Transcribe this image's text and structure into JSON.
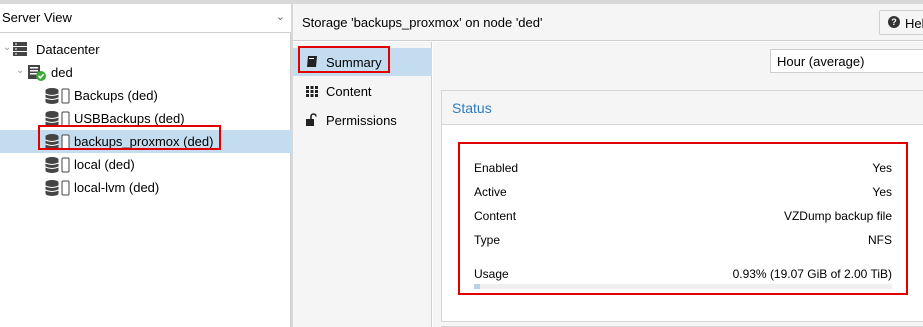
{
  "tree": {
    "view_selector": "Server View",
    "datacenter": "Datacenter",
    "node": "ded",
    "storages": [
      "Backups (ded)",
      "USBBackups (ded)",
      "backups_proxmox (ded)",
      "local (ded)",
      "local-lvm (ded)"
    ],
    "selected_index": 2
  },
  "header": {
    "title": "Storage 'backups_proxmox' on node 'ded'",
    "help_label": "Hel"
  },
  "subnav": {
    "items": [
      "Summary",
      "Content",
      "Permissions"
    ],
    "active": "Summary"
  },
  "toolbar": {
    "timeframe": "Hour (average)"
  },
  "status": {
    "title": "Status",
    "rows": [
      {
        "label": "Enabled",
        "value": "Yes"
      },
      {
        "label": "Active",
        "value": "Yes"
      },
      {
        "label": "Content",
        "value": "VZDump backup file"
      },
      {
        "label": "Type",
        "value": "NFS"
      }
    ],
    "usage_label": "Usage",
    "usage_value": "0.93% (19.07 GiB of 2.00 TiB)",
    "usage_fraction": 0.0093
  },
  "colors": {
    "selection": "#c3dcf0",
    "highlight": "#e00000",
    "status_title": "#2f7dbf",
    "ok_badge": "#3aaa35"
  }
}
